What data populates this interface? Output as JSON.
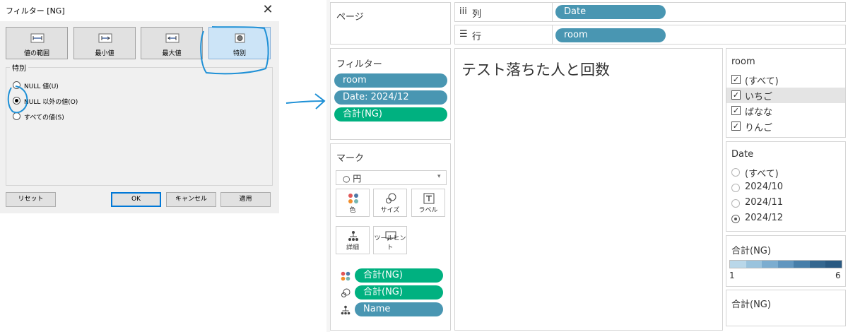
{
  "dialog": {
    "title": "フィルター [NG]",
    "close_glyph": "✕",
    "tabs": [
      {
        "label": "値の範囲",
        "icon": "range-icon"
      },
      {
        "label": "最小値",
        "icon": "min-value-icon"
      },
      {
        "label": "最大値",
        "icon": "max-value-icon"
      },
      {
        "label": "特別",
        "icon": "special-icon",
        "active": true
      }
    ],
    "group_label": "特別",
    "options": [
      {
        "label": "NULL 値(U)",
        "selected": false
      },
      {
        "label": "NULL 以外の値(O)",
        "selected": true
      },
      {
        "label": "すべての値(S)",
        "selected": false
      }
    ],
    "buttons": {
      "reset": "リセット",
      "ok": "OK",
      "cancel": "キャンセル",
      "apply": "適用"
    }
  },
  "tableau": {
    "pages": {
      "title": "ページ"
    },
    "shelves": {
      "columns": {
        "icon": "iii",
        "label": "列",
        "pill": "Date"
      },
      "rows": {
        "icon": "☰",
        "label": "行",
        "pill": "room"
      }
    },
    "filters": {
      "title": "フィルター",
      "pills": [
        "room",
        "Date: 2024/12",
        "合計(NG)"
      ]
    },
    "marks": {
      "title": "マーク",
      "type": "○ 円",
      "type_arrow": "▾",
      "buttons": {
        "color": "色",
        "size": "サイズ",
        "label": "ラベル",
        "detail": "詳細",
        "tooltip": "ツールヒント"
      },
      "fields": [
        "合計(NG)",
        "合計(NG)",
        "Name"
      ]
    },
    "view_title": "テスト落ちた人と回数",
    "room_filter": {
      "title": "room",
      "items": [
        {
          "label": "(すべて)",
          "checked": true
        },
        {
          "label": "いちご",
          "checked": true
        },
        {
          "label": "ばなな",
          "checked": true
        },
        {
          "label": "りんご",
          "checked": true
        }
      ],
      "check_glyph": "✓"
    },
    "date_filter": {
      "title": "Date",
      "items": [
        {
          "label": "(すべて)",
          "selected": false
        },
        {
          "label": "2024/10",
          "selected": false
        },
        {
          "label": "2024/11",
          "selected": false
        },
        {
          "label": "2024/12",
          "selected": true
        }
      ]
    },
    "color_legend": {
      "title": "合計(NG)",
      "min": "1",
      "max": "6",
      "colors": [
        "#b9d7e9",
        "#9ac3dd",
        "#7cadd0",
        "#6196bf",
        "#477ea9",
        "#35678f",
        "#2a5a82"
      ]
    },
    "size_legend": {
      "title": "合計(NG)"
    }
  },
  "colors": {
    "pill_blue": "#4996b2",
    "pill_green": "#00b180",
    "annotation": "#1e90d6",
    "selection": "#cce4f7"
  }
}
